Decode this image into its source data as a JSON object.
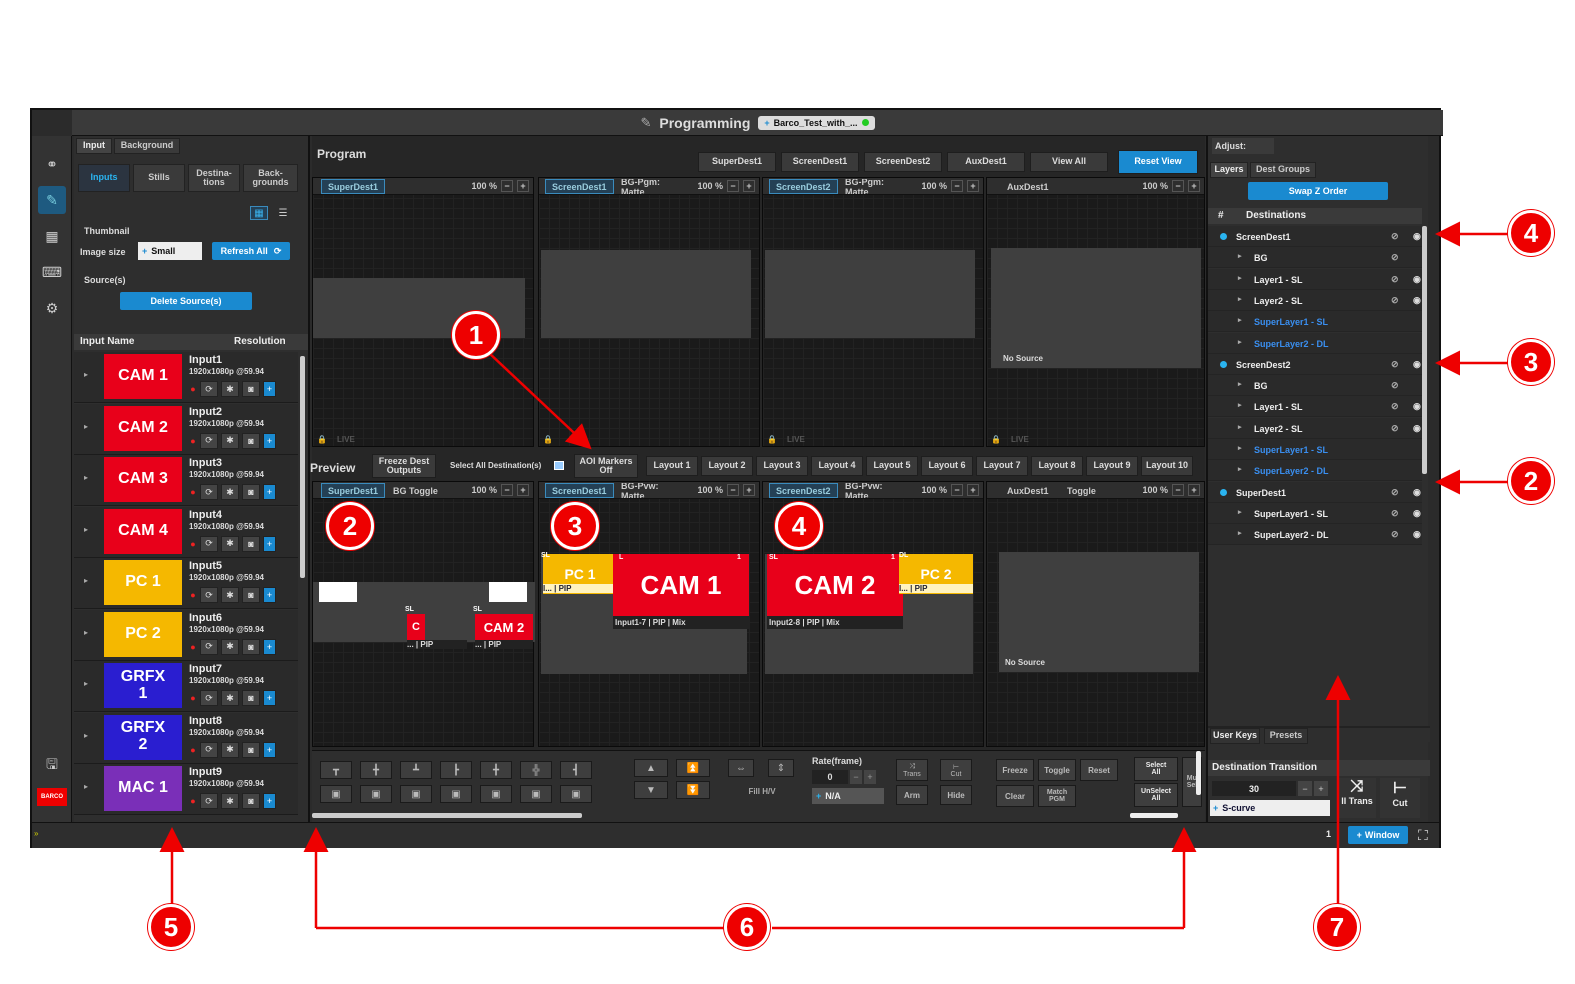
{
  "title": "Programming",
  "preset_pill": "Barco_Test_with_...",
  "input_panel": {
    "tabs": [
      "Input",
      "Background"
    ],
    "subtabs": [
      "Inputs",
      "Stills",
      "Destina-\ntions",
      "Back-\ngrounds"
    ],
    "thumbnail_label": "Thumbnail",
    "image_size_label": "Image size",
    "image_size_value": "Small",
    "refresh_all": "Refresh All",
    "sources_label": "Source(s)",
    "delete_sources": "Delete Source(s)",
    "col_name": "Input Name",
    "col_res": "Resolution",
    "inputs": [
      {
        "thumb": "CAM 1",
        "name": "Input1",
        "res": "1920x1080p @59.94",
        "color": "#e8001a"
      },
      {
        "thumb": "CAM 2",
        "name": "Input2",
        "res": "1920x1080p @59.94",
        "color": "#e8001a"
      },
      {
        "thumb": "CAM 3",
        "name": "Input3",
        "res": "1920x1080p @59.94",
        "color": "#e8001a"
      },
      {
        "thumb": "CAM 4",
        "name": "Input4",
        "res": "1920x1080p @59.94",
        "color": "#e8001a"
      },
      {
        "thumb": "PC 1",
        "name": "Input5",
        "res": "1920x1080p @59.94",
        "color": "#f5b800"
      },
      {
        "thumb": "PC 2",
        "name": "Input6",
        "res": "1920x1080p @59.94",
        "color": "#f5b800"
      },
      {
        "thumb": "GRFX\n1",
        "name": "Input7",
        "res": "1920x1080p @59.94",
        "color": "#2a1ed0"
      },
      {
        "thumb": "GRFX\n2",
        "name": "Input8",
        "res": "1920x1080p @59.94",
        "color": "#2a1ed0"
      },
      {
        "thumb": "MAC 1",
        "name": "Input9",
        "res": "1920x1080p @59.94",
        "color": "#7a2fb8"
      }
    ]
  },
  "program": {
    "label": "Program",
    "buttons": [
      "SuperDest1",
      "ScreenDest1",
      "ScreenDest2",
      "AuxDest1",
      "View All",
      "Reset View"
    ],
    "dests": [
      {
        "chip": "SuperDest1",
        "extra": "",
        "zoom": "100 %"
      },
      {
        "chip": "ScreenDest1",
        "extra": "BG-Pgm: Matte",
        "zoom": "100 %"
      },
      {
        "chip": "ScreenDest2",
        "extra": "BG-Pgm: Matte",
        "zoom": "100 %"
      },
      {
        "chip": "AuxDest1",
        "extra": "",
        "zoom": "100 %"
      }
    ],
    "live": "LIVE",
    "no_source": "No Source"
  },
  "preview": {
    "label": "Preview",
    "freeze": "Freeze Dest\nOutputs",
    "select_all": "Select All Destination(s)",
    "aoi": "AOI Markers\nOff",
    "layouts": [
      "Layout 1",
      "Layout 2",
      "Layout 3",
      "Layout 4",
      "Layout 5",
      "Layout 6",
      "Layout 7",
      "Layout 8",
      "Layout 9",
      "Layout 10"
    ],
    "dests": [
      {
        "chip": "SuperDest1",
        "extra": "BG Toggle",
        "zoom": "100 %"
      },
      {
        "chip": "ScreenDest1",
        "extra": "BG-Pvw: Matte",
        "zoom": "100 %"
      },
      {
        "chip": "ScreenDest2",
        "extra": "BG-Pvw: Matte",
        "zoom": "100 %"
      },
      {
        "chip": "AuxDest1",
        "extra": "Toggle",
        "zoom": "100 %"
      }
    ],
    "layers": {
      "pc1": "PC 1",
      "pc1_cap": "I... | PIP",
      "cam1": "CAM 1",
      "cam1_cap": "Input1-7 | PIP | Mix",
      "cam2": "CAM 2",
      "cam2_cap": "Input2-8 | PIP | Mix",
      "pc2": "PC 2",
      "pc2_cap": "I... | PIP",
      "small_cam2": "CAM 2",
      "small_c": "C",
      "small_cap1": "... | PIP",
      "small_cap2": "... | PIP",
      "sl": "SL",
      "l": "L",
      "dl": "DL",
      "one": "1"
    },
    "no_source": "No Source"
  },
  "toolbar": {
    "rate_label": "Rate(frame)",
    "rate_value": "0",
    "trans": "Trans",
    "cut": "Cut",
    "arm": "Arm",
    "hide": "Hide",
    "fill": "Fill H/V",
    "na": "N/A",
    "freeze": "Freeze",
    "toggle": "Toggle",
    "reset": "Reset",
    "clear": "Clear",
    "match_pgm": "Match\nPGM",
    "select_all": "Select\nAll",
    "unselect_all": "UnSelect\nAll",
    "mu": "Mu\nSel"
  },
  "right_panel": {
    "adjust": "Adjust:",
    "tabs": [
      "Layers",
      "Dest Groups"
    ],
    "swap": "Swap Z Order",
    "hash": "#",
    "destinations": "Destinations",
    "tree": [
      {
        "t": "ScreenDest1",
        "lvl": 0
      },
      {
        "t": "BG",
        "lvl": 1
      },
      {
        "t": "Layer1 - SL",
        "lvl": 1
      },
      {
        "t": "Layer2 - SL",
        "lvl": 1
      },
      {
        "t": "SuperLayer1 - SL",
        "lvl": 1,
        "blue": true
      },
      {
        "t": "SuperLayer2 - DL",
        "lvl": 1,
        "blue": true
      },
      {
        "t": "ScreenDest2",
        "lvl": 0
      },
      {
        "t": "BG",
        "lvl": 1
      },
      {
        "t": "Layer1 - SL",
        "lvl": 1
      },
      {
        "t": "Layer2 - SL",
        "lvl": 1
      },
      {
        "t": "SuperLayer1 - SL",
        "lvl": 1,
        "blue": true
      },
      {
        "t": "SuperLayer2 - DL",
        "lvl": 1,
        "blue": true
      },
      {
        "t": "SuperDest1",
        "lvl": 0
      },
      {
        "t": "SuperLayer1 - SL",
        "lvl": 1
      },
      {
        "t": "SuperLayer2 - DL",
        "lvl": 1
      }
    ],
    "bottom_tabs": [
      "User Keys",
      "Presets"
    ],
    "dest_transition": "Destination Transition",
    "rate": "30",
    "curve": "S-curve",
    "all_trans": "ll Trans",
    "cut": "Cut"
  },
  "bottom_bar": {
    "page": "1",
    "window": "Window"
  },
  "annotations": [
    "1",
    "2",
    "3",
    "4",
    "2",
    "3",
    "4",
    "5",
    "6",
    "7"
  ]
}
